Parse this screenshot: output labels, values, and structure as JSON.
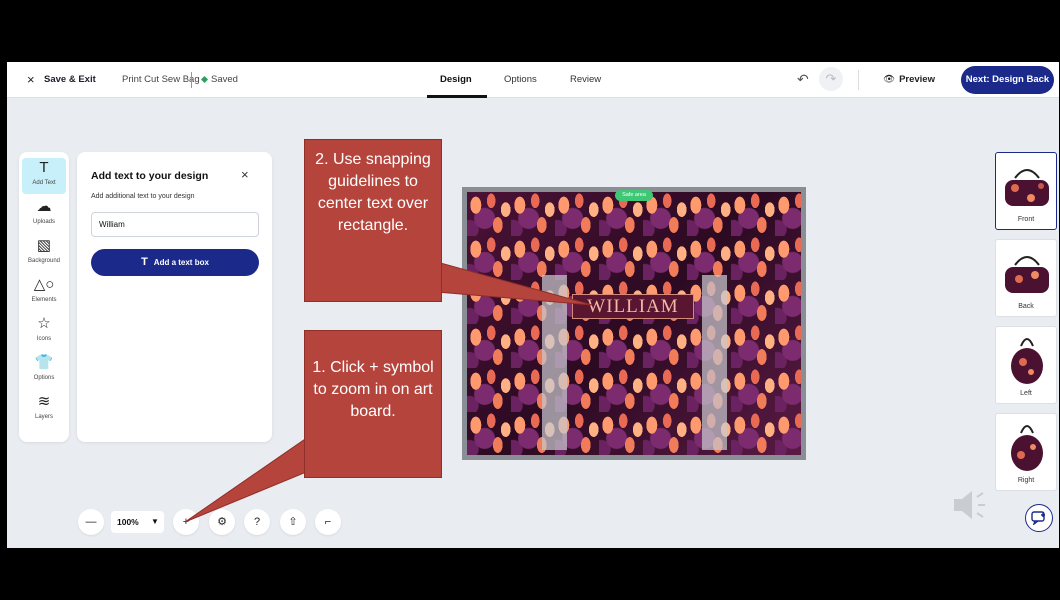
{
  "topbar": {
    "exit_icon": "×",
    "exit_label": "Save & Exit",
    "doc_name": "Print Cut Sew Bag",
    "saved_label": "Saved",
    "tabs": [
      {
        "label": "Design",
        "active": true
      },
      {
        "label": "Options",
        "active": false
      },
      {
        "label": "Review",
        "active": false
      }
    ],
    "undo_icon": "↶",
    "redo_icon": "↷",
    "preview_label": "Preview",
    "preview_icon": "👁",
    "next_label": "Next: Design Back"
  },
  "left_tools": [
    {
      "label": "Add Text",
      "icon": "T",
      "icon_name": "text-icon",
      "active": true
    },
    {
      "label": "Uploads",
      "icon": "☁",
      "icon_name": "upload-icon",
      "active": false
    },
    {
      "label": "Background",
      "icon": "▧",
      "icon_name": "background-icon",
      "active": false
    },
    {
      "label": "Elements",
      "icon": "△○",
      "icon_name": "elements-icon",
      "active": false
    },
    {
      "label": "Icons",
      "icon": "☆",
      "icon_name": "star-icon",
      "active": false
    },
    {
      "label": "Options",
      "icon": "👕",
      "icon_name": "shirt-icon",
      "active": false
    },
    {
      "label": "Layers",
      "icon": "≋",
      "icon_name": "layers-icon",
      "active": false
    }
  ],
  "text_panel": {
    "title": "Add text to your design",
    "close_icon": "×",
    "subtitle": "Add additional text to your design",
    "input_value": "William",
    "add_button_icon": "T",
    "add_button_label": "Add a text box"
  },
  "canvas": {
    "safe_area_label": "Safe area",
    "text_box_value": "WILLIAM"
  },
  "thumbnails": [
    {
      "label": "Front",
      "active": true
    },
    {
      "label": "Back",
      "active": false
    },
    {
      "label": "Left",
      "active": false
    },
    {
      "label": "Right",
      "active": false
    }
  ],
  "bottom_toolbar": {
    "zoom_out_icon": "—",
    "zoom_value": "100%",
    "zoom_caret": "▼",
    "zoom_in_icon": "+",
    "settings_icon": "⚙",
    "help_icon": "?",
    "share_icon": "⇧",
    "crop_icon": "⌐"
  },
  "annotations": {
    "callout_2": "2. Use snapping guidelines to center text over rectangle.",
    "callout_1": "1. Click + symbol to zoom in on art board."
  },
  "colors": {
    "accent": "#1b2a8a",
    "callout": "#b5453c",
    "active_tool": "#c8f0fb",
    "saved": "#2e9e5b"
  }
}
